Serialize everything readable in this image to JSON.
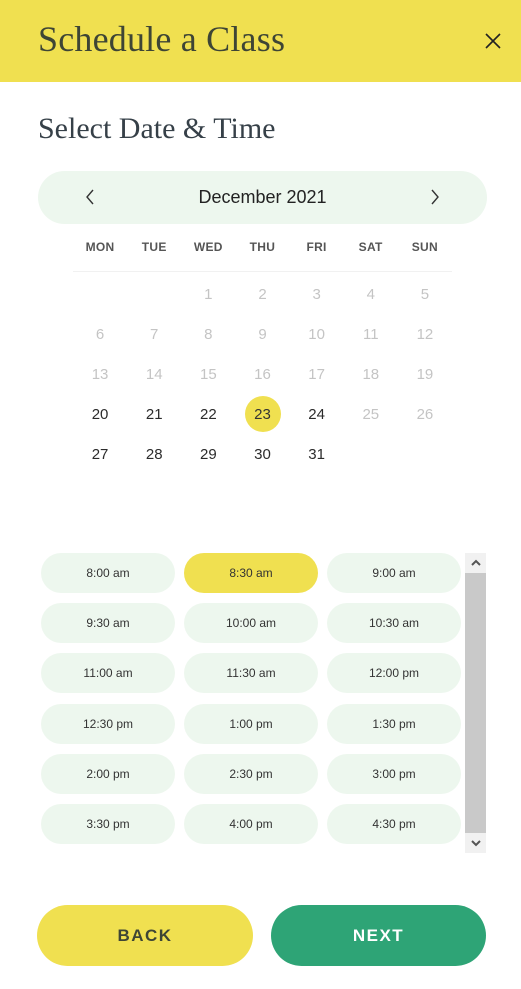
{
  "header": {
    "title": "Schedule a Class",
    "close_icon": "close-icon"
  },
  "section_title": "Select Date & Time",
  "calendar": {
    "month_label": "December 2021",
    "prev_icon": "chevron-left-icon",
    "next_icon": "chevron-right-icon",
    "weekdays": [
      "MON",
      "TUE",
      "WED",
      "THU",
      "FRI",
      "SAT",
      "SUN"
    ],
    "first_weekday_index": 2,
    "days_in_month": 31,
    "available_days": [
      20,
      21,
      22,
      23,
      24,
      27,
      28,
      29,
      30,
      31
    ],
    "selected_day": 23
  },
  "time_slots": {
    "items": [
      "8:00 am",
      "8:30 am",
      "9:00 am",
      "9:30 am",
      "10:00 am",
      "10:30 am",
      "11:00 am",
      "11:30 am",
      "12:00 pm",
      "12:30 pm",
      "1:00 pm",
      "1:30 pm",
      "2:00 pm",
      "2:30 pm",
      "3:00 pm",
      "3:30 pm",
      "4:00 pm",
      "4:30 pm"
    ],
    "selected": "8:30 am"
  },
  "buttons": {
    "back_label": "BACK",
    "next_label": "NEXT"
  },
  "colors": {
    "accent_yellow": "#f0e050",
    "accent_green": "#2ea476",
    "slot_bg": "#edf7ee"
  }
}
